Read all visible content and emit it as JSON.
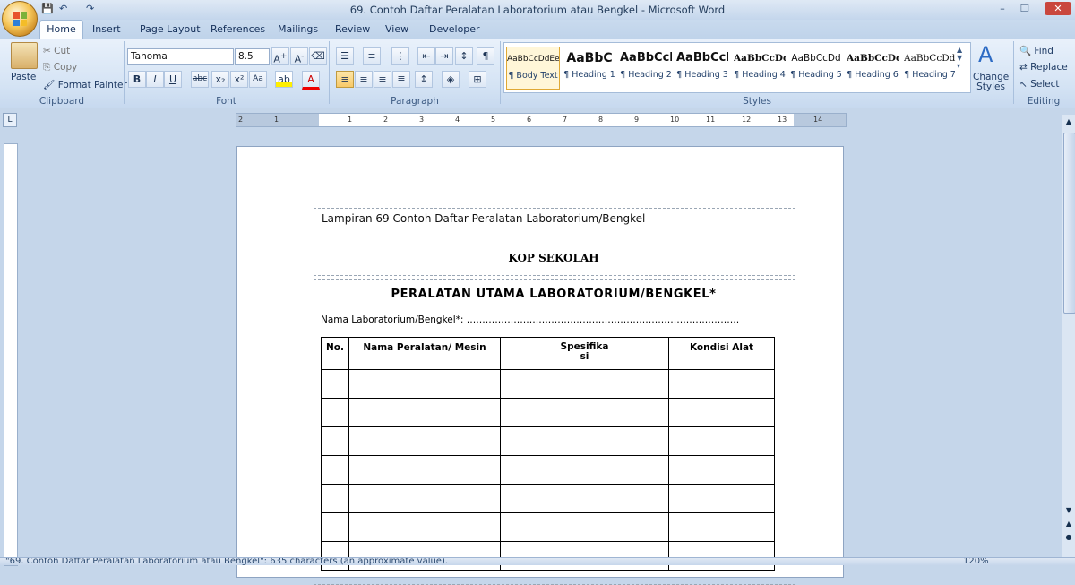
{
  "window": {
    "title": "69. Contoh Daftar Peralatan Laboratorium atau Bengkel - Microsoft Word",
    "controls": [
      "–",
      "❐",
      "✕"
    ]
  },
  "qat": {
    "save": "💾",
    "undo": "↶",
    "redo": "↷"
  },
  "tabs": [
    "Home",
    "Insert",
    "Page Layout",
    "References",
    "Mailings",
    "Review",
    "View",
    "Developer"
  ],
  "ribbon": {
    "clipboard": {
      "label": "Clipboard",
      "paste": "Paste",
      "cut": "Cut",
      "copy": "Copy",
      "format_painter": "Format Painter"
    },
    "font": {
      "label": "Font",
      "family": "Tahoma",
      "size": "8.5"
    },
    "paragraph": {
      "label": "Paragraph"
    },
    "styles": {
      "label": "Styles",
      "items": [
        {
          "preview": "AaBbCcDdEe",
          "name": "¶ Body Text"
        },
        {
          "preview": "AaBbC",
          "name": "¶ Heading 1"
        },
        {
          "preview": "AaBbCcl",
          "name": "¶ Heading 2"
        },
        {
          "preview": "AaBbCcI",
          "name": "¶ Heading 3"
        },
        {
          "preview": "AaBbCcDd",
          "name": "¶ Heading 4"
        },
        {
          "preview": "AaBbCcDd",
          "name": "¶ Heading 5"
        },
        {
          "preview": "AaBbCcDdI",
          "name": "¶ Heading 6"
        },
        {
          "preview": "AaBbCcDdI",
          "name": "¶ Heading 7"
        }
      ],
      "change_styles": "Change Styles"
    },
    "editing": {
      "label": "Editing",
      "find": "Find",
      "replace": "Replace",
      "select": "Select"
    }
  },
  "ruler": {
    "ticks": [
      "2",
      "1",
      "1",
      "2",
      "3",
      "4",
      "5",
      "6",
      "7",
      "8",
      "9",
      "10",
      "11",
      "12",
      "13",
      "14"
    ]
  },
  "document": {
    "caption": "Lampiran 69 Contoh Daftar Peralatan Laboratorium/Bengkel",
    "kop": "KOP SEKOLAH",
    "heading": "PERALATAN  UTAMA LABORATORIUM/BENGKEL*",
    "lab_name": "Nama Laboratorium/Bengkel*: ……………………………………………………………………………",
    "table": {
      "headers": [
        "No.",
        "Nama Peralatan/ Mesin",
        "Spesifika\nsi",
        "Kondisi  Alat"
      ],
      "rows": 7
    }
  },
  "statusbar": {
    "text": "\"69. Contoh Daftar Peralatan Laboratorium atau Bengkel\": 635 characters (an approximate value).",
    "zoom": "120%"
  }
}
